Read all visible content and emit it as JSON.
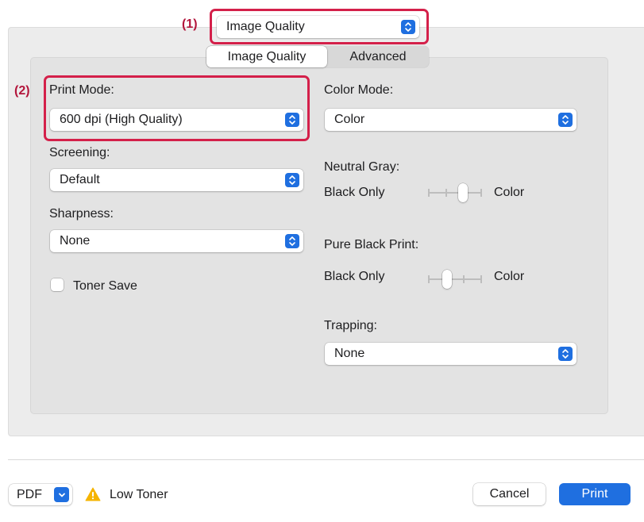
{
  "preset_menu": {
    "annotation": "(1)",
    "value": "Image Quality"
  },
  "tabs": [
    {
      "label": "Image Quality",
      "selected": true
    },
    {
      "label": "Advanced",
      "selected": false
    }
  ],
  "left_column": {
    "print_mode": {
      "annotation": "(2)",
      "label": "Print Mode:",
      "value": "600 dpi (High Quality)"
    },
    "screening": {
      "label": "Screening:",
      "value": "Default"
    },
    "sharpness": {
      "label": "Sharpness:",
      "value": "None"
    },
    "toner_save": {
      "label": "Toner Save",
      "checked": false
    }
  },
  "right_column": {
    "color_mode": {
      "label": "Color Mode:",
      "value": "Color"
    },
    "neutral_gray": {
      "label": "Neutral Gray:",
      "min_label": "Black Only",
      "max_label": "Color",
      "level": 0.67
    },
    "pure_black_print": {
      "label": "Pure Black Print:",
      "min_label": "Black Only",
      "max_label": "Color",
      "level": 0.33
    },
    "trapping": {
      "label": "Trapping:",
      "value": "None"
    }
  },
  "footer": {
    "pdf_label": "PDF",
    "status_text": "Low Toner",
    "cancel_label": "Cancel",
    "print_label": "Print"
  },
  "icons": {
    "stepper": "up-down-chevron-icon",
    "pdf_menu": "chevron-down-icon",
    "warning": "warning-triangle-icon"
  },
  "colors": {
    "accent": "#1f6fe0",
    "highlight": "#d4204a",
    "warning": "#f5b400"
  }
}
